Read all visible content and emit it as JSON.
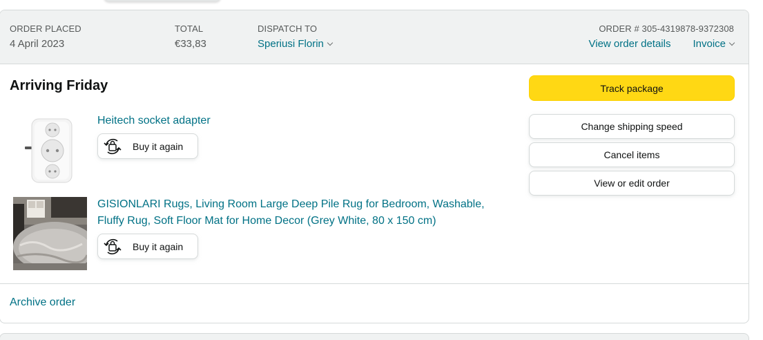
{
  "header": {
    "order_placed_label": "ORDER PLACED",
    "order_placed_value": "4 April 2023",
    "total_label": "TOTAL",
    "total_value": "€33,83",
    "dispatch_label": "DISPATCH TO",
    "dispatch_value": "Speriusi Florin",
    "order_number": "ORDER # 305-4319878-9372308",
    "view_details_label": "View order details",
    "invoice_label": "Invoice"
  },
  "shipment": {
    "status": "Arriving Friday",
    "items": [
      {
        "title": "Heitech socket adapter",
        "buy_again_label": "Buy it again",
        "thumb_icon": "socket-adapter-thumbnail"
      },
      {
        "title_line1": "GISIONLARI Rugs, Living Room Large Deep Pile Rug for Bedroom, Washable,",
        "title_line2": "Fluffy Rug, Soft Floor Mat for Home Decor (Grey White, 80 x 150 cm)",
        "buy_again_label": "Buy it again",
        "thumb_icon": "grey-rug-thumbnail"
      }
    ]
  },
  "actions": {
    "track_package": "Track package",
    "change_shipping_speed": "Change shipping speed",
    "cancel_items": "Cancel items",
    "view_or_edit_order": "View or edit order"
  },
  "footer": {
    "archive_order": "Archive order"
  },
  "colors": {
    "link": "#007185",
    "primary_button": "#FFD814",
    "header_bg": "#F0F2F2",
    "border": "#D5D9D9"
  }
}
